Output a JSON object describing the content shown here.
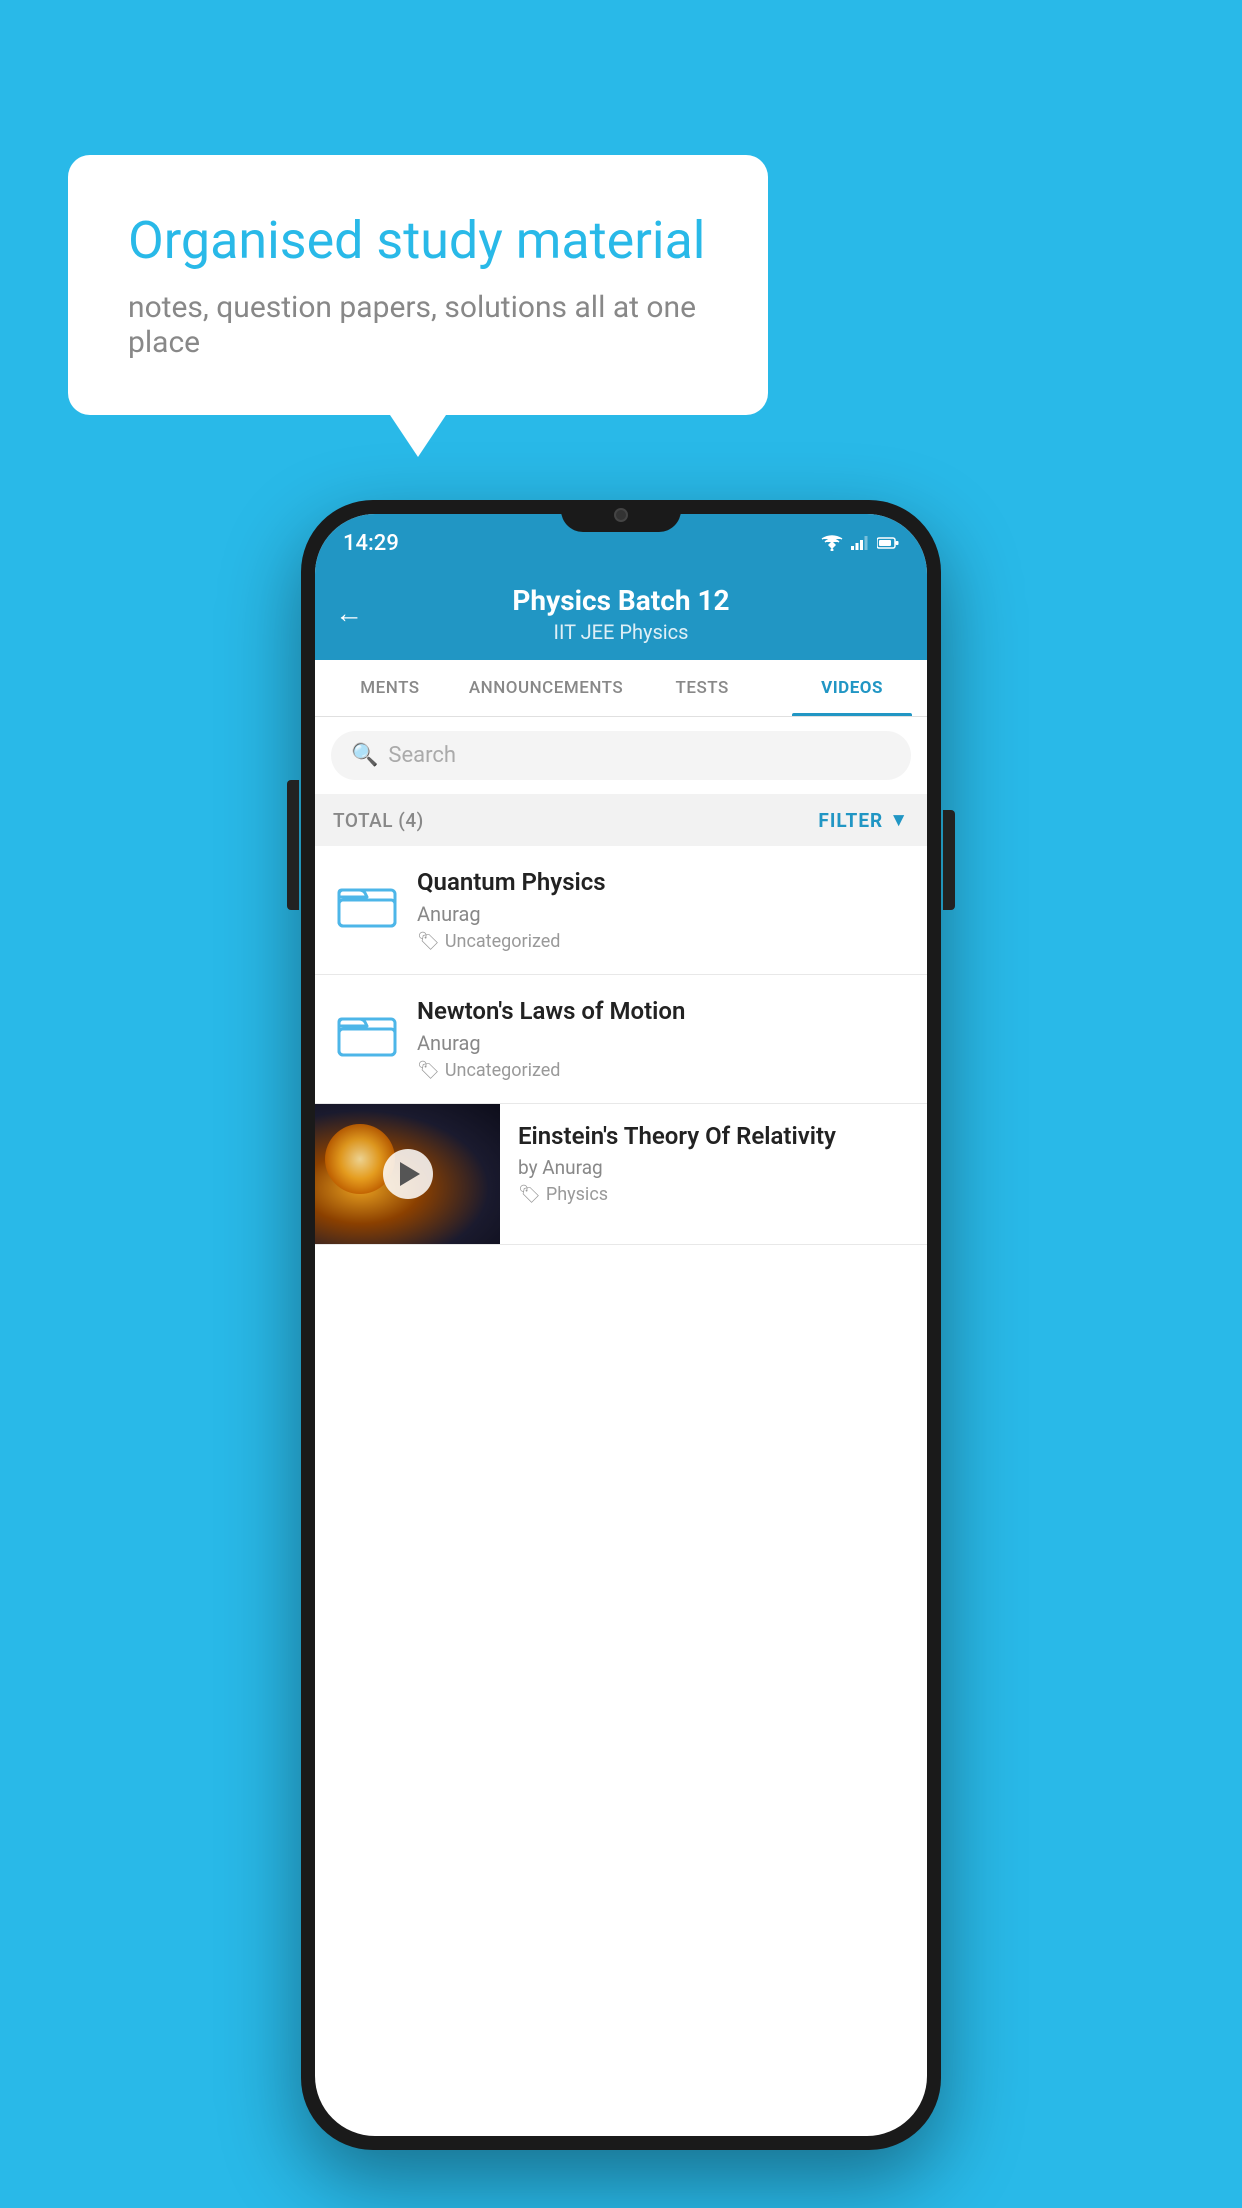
{
  "background_color": "#29b9e8",
  "speech_bubble": {
    "title": "Organised study material",
    "subtitle": "notes, question papers, solutions all at one place"
  },
  "status_bar": {
    "time": "14:29"
  },
  "app_header": {
    "title": "Physics Batch 12",
    "subtitle": "IIT JEE   Physics",
    "back_label": "←"
  },
  "tabs": [
    {
      "label": "MENTS",
      "active": false
    },
    {
      "label": "ANNOUNCEMENTS",
      "active": false
    },
    {
      "label": "TESTS",
      "active": false
    },
    {
      "label": "VIDEOS",
      "active": true
    }
  ],
  "search": {
    "placeholder": "Search"
  },
  "filter_row": {
    "total_label": "TOTAL (4)",
    "filter_label": "FILTER"
  },
  "video_items": [
    {
      "title": "Quantum Physics",
      "author": "Anurag",
      "tag": "Uncategorized",
      "has_thumbnail": false
    },
    {
      "title": "Newton's Laws of Motion",
      "author": "Anurag",
      "tag": "Uncategorized",
      "has_thumbnail": false
    },
    {
      "title": "Einstein's Theory Of Relativity",
      "author": "by Anurag",
      "tag": "Physics",
      "has_thumbnail": true
    }
  ]
}
